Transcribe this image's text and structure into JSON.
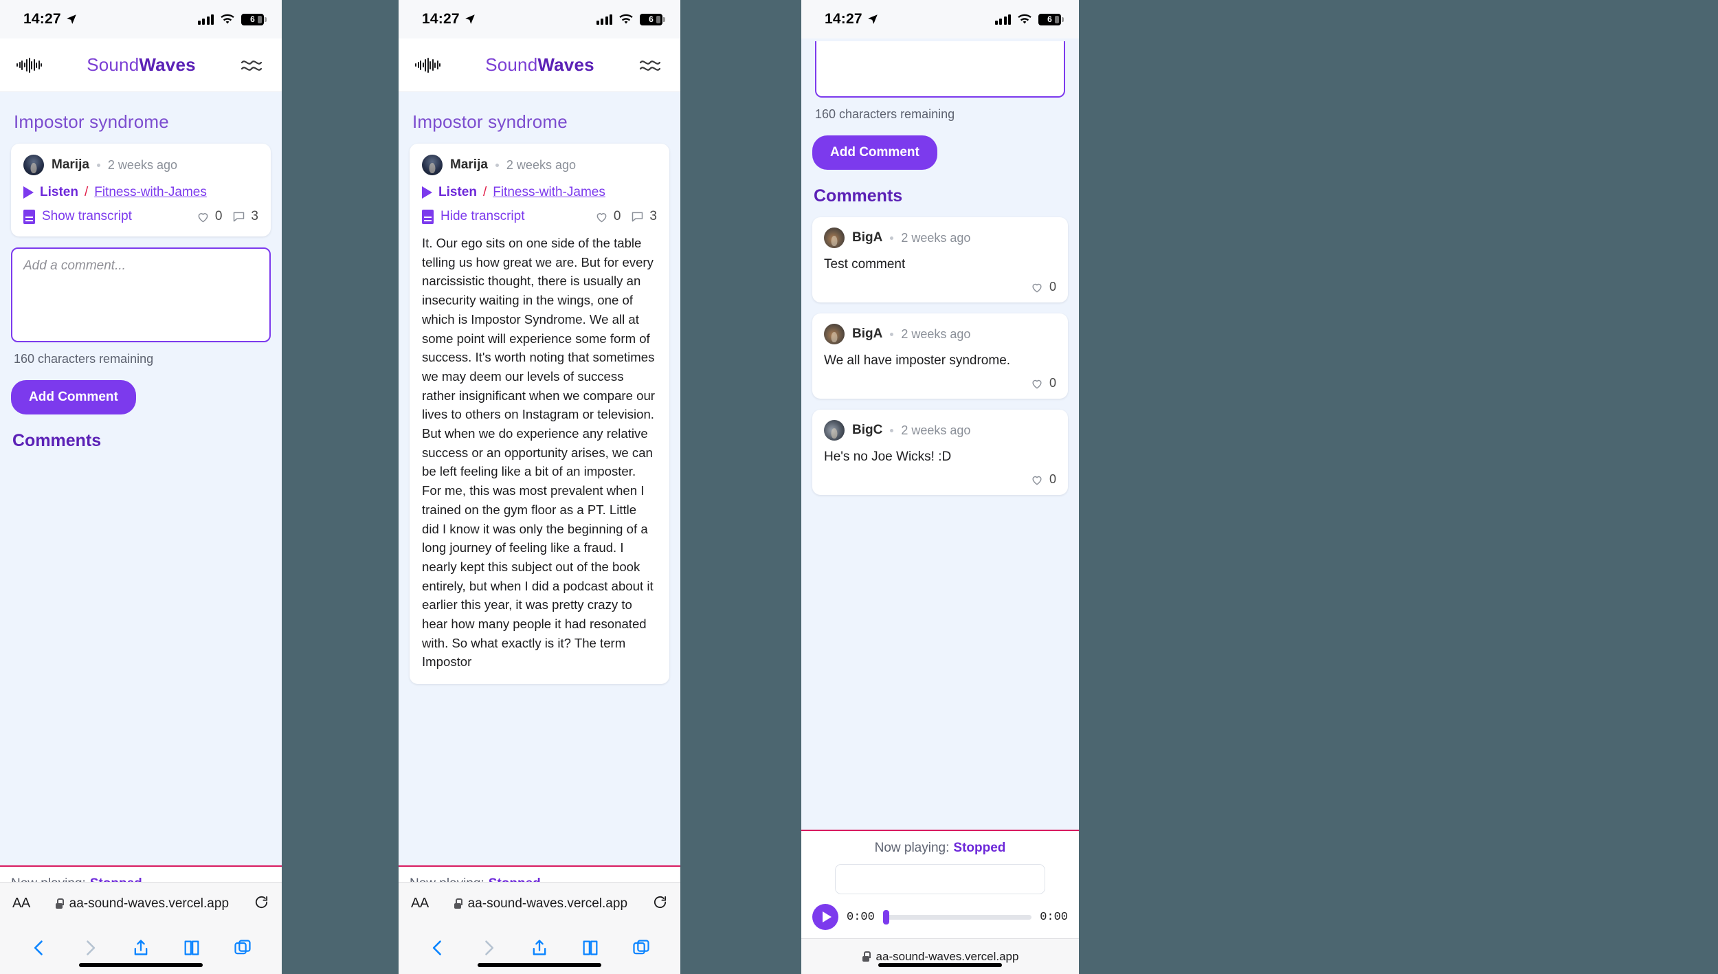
{
  "status_bar": {
    "time": "14:27",
    "location_icon": "location-arrow-icon",
    "battery_level": "6"
  },
  "app": {
    "brand_light": "Sound",
    "brand_bold": "Waves",
    "logo_icon": "waveform-icon",
    "menu_icon": "wave-menu-icon"
  },
  "page": {
    "title": "Impostor syndrome"
  },
  "episode": {
    "author": "Marija",
    "separator_dot": "•",
    "time_ago": "2 weeks ago",
    "listen_label": "Listen",
    "slash": "/",
    "podcast": "Fitness-with-James",
    "transcript_show": "Show transcript",
    "transcript_hide": "Hide transcript",
    "like_count": "0",
    "comment_count": "3",
    "transcript_text": "It. Our ego sits on one side of the table telling us how great we are. But for every narcissistic thought, there is usually an insecurity waiting in the wings, one of which is Impostor Syndrome. We all at some point will experience some form of success. It's worth noting that sometimes we may deem our levels of success rather insignificant when we compare our lives to others on Instagram or television. But when we do experience any relative success or an opportunity arises, we can be left feeling like a bit of an imposter. For me, this was most prevalent when I trained on the gym floor as a PT. Little did I know it was only the beginning of a long journey of feeling like a fraud. I nearly kept this subject out of the book entirely, but when I did a podcast about it earlier this year, it was pretty crazy to hear how many people it had resonated with. So what exactly is it? The term Impostor"
  },
  "composer": {
    "placeholder": "Add a comment...",
    "characters_remaining": "160 characters remaining",
    "submit_label": "Add Comment"
  },
  "comments_section": {
    "heading": "Comments",
    "items": [
      {
        "author": "BigA",
        "time_ago": "2 weeks ago",
        "text": "Test comment",
        "likes": "0"
      },
      {
        "author": "BigA",
        "time_ago": "2 weeks ago",
        "text": "We all have imposter syndrome.",
        "likes": "0"
      },
      {
        "author": "BigC",
        "time_ago": "2 weeks ago",
        "text": "He's no Joe Wicks! :D",
        "likes": "0"
      }
    ]
  },
  "player": {
    "now_playing_label": "Now playing:",
    "status": "Stopped",
    "elapsed": "0:00",
    "duration": "0:00",
    "play_icon": "play-icon"
  },
  "browser": {
    "text_size_label": "AA",
    "url": "aa-sound-waves.vercel.app",
    "lock_icon": "lock-icon",
    "reload_icon": "reload-icon",
    "back_icon": "chevron-left-icon",
    "forward_icon": "chevron-right-icon",
    "share_icon": "share-icon",
    "bookmarks_icon": "book-icon",
    "tabs_icon": "tabs-icon"
  },
  "colors": {
    "accent": "#7c3aed",
    "brand_dark": "#5b21b6",
    "page_bg": "#eef4fd",
    "player_border": "#d81b60",
    "safari_blue": "#0a84ff"
  }
}
